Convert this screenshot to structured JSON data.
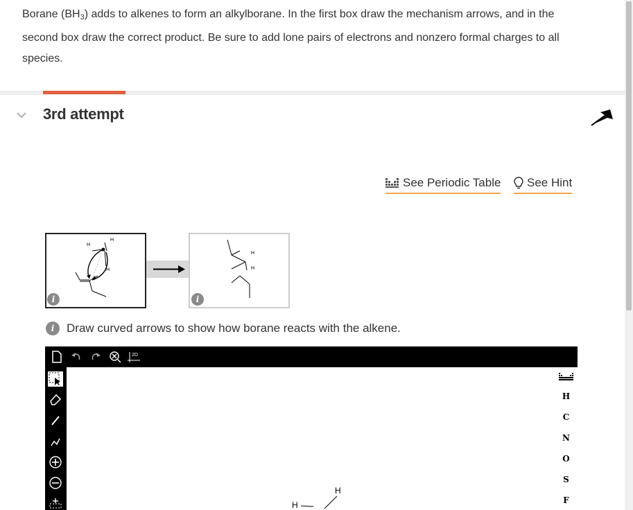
{
  "question": {
    "part1": "Borane (BH",
    "subscript": "3",
    "part2": ") adds to alkenes to form an alkylborane. In the first box draw the mechanism arrows, and in the second box draw the correct product. Be sure to add lone pairs of electrons and nonzero formal charges to all species."
  },
  "attempt": {
    "title": "3rd attempt"
  },
  "links": {
    "periodic": "See Periodic Table",
    "hint": "See Hint"
  },
  "steps": {
    "step1_labels": {
      "h1": "H",
      "h2": "H",
      "h3": "H"
    },
    "step2_labels": {
      "h1": "H",
      "h2": "H"
    },
    "info_glyph": "i"
  },
  "instruction": "Draw curved arrows to show how borane reacts with the alkene.",
  "editor": {
    "top_tools": [
      "new-document-icon",
      "undo-icon",
      "redo-icon",
      "clear-icon",
      "2d-icon"
    ],
    "twod_label": "2D",
    "left_tools": [
      "select-icon",
      "eraser-icon",
      "bond-icon",
      "chain-icon",
      "positive-charge-icon",
      "negative-charge-icon",
      "lone-pair-icon"
    ],
    "elements": [
      "H",
      "C",
      "N",
      "O",
      "S",
      "F"
    ],
    "canvas_labels": {
      "h_left": "H",
      "h_top": "H"
    }
  }
}
